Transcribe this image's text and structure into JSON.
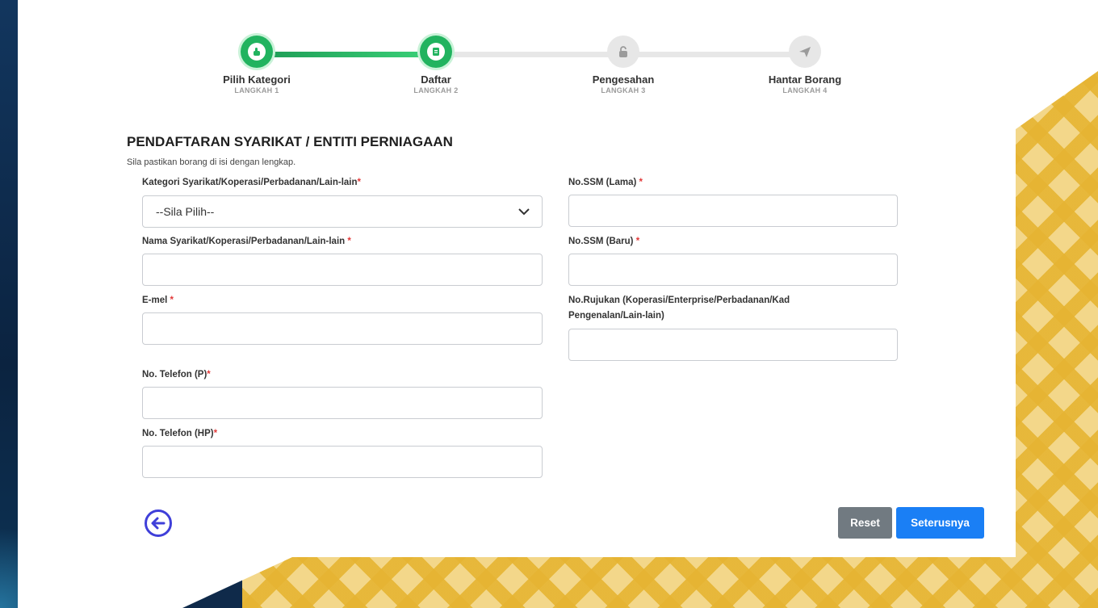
{
  "stepper": {
    "steps": [
      {
        "title": "Pilih Kategori",
        "sub": "LANGKAH 1",
        "state": "done",
        "icon": "hand-pointer-icon"
      },
      {
        "title": "Daftar",
        "sub": "LANGKAH 2",
        "state": "current",
        "icon": "document-icon"
      },
      {
        "title": "Pengesahan",
        "sub": "LANGKAH 3",
        "state": "pending",
        "icon": "lock-icon"
      },
      {
        "title": "Hantar Borang",
        "sub": "LANGKAH 4",
        "state": "pending",
        "icon": "paper-plane-icon"
      }
    ],
    "colors": {
      "active": "#21b35f",
      "inactive": "#e7e7e7"
    }
  },
  "form": {
    "heading": "PENDAFTARAN SYARIKAT / ENTITI PERNIAGAAN",
    "subheading": "Sila pastikan borang di isi dengan lengkap.",
    "kategori": {
      "label": "Kategori Syarikat/Koperasi/Perbadanan/Lain-lain",
      "required": "*",
      "value": "--Sila Pilih--"
    },
    "nama": {
      "label": "Nama Syarikat/Koperasi/Perbadanan/Lain-lain",
      "required": "*",
      "value": ""
    },
    "emel": {
      "label": "E-mel",
      "required": "*",
      "value": ""
    },
    "telefon_p": {
      "label": "No. Telefon (P)",
      "required": "*",
      "value": ""
    },
    "telefon_hp": {
      "label": "No. Telefon (HP)",
      "required": "*",
      "value": ""
    },
    "ssm_lama": {
      "label": "No.SSM (Lama)",
      "required": "*",
      "value": ""
    },
    "ssm_baru": {
      "label": "No.SSM (Baru)",
      "required": "*",
      "value": ""
    },
    "rujukan": {
      "label_line1": "No.Rujukan (Koperasi/Enterprise/Perbadanan/Kad",
      "label_line2": "Pengenalan/Lain-lain)",
      "value": ""
    }
  },
  "actions": {
    "reset_label": "Reset",
    "next_label": "Seterusnya",
    "back_icon": "arrow-left-circle-icon",
    "colors": {
      "reset": "#717a81",
      "next": "#1a7ff5",
      "back": "#3f3fd9"
    }
  }
}
